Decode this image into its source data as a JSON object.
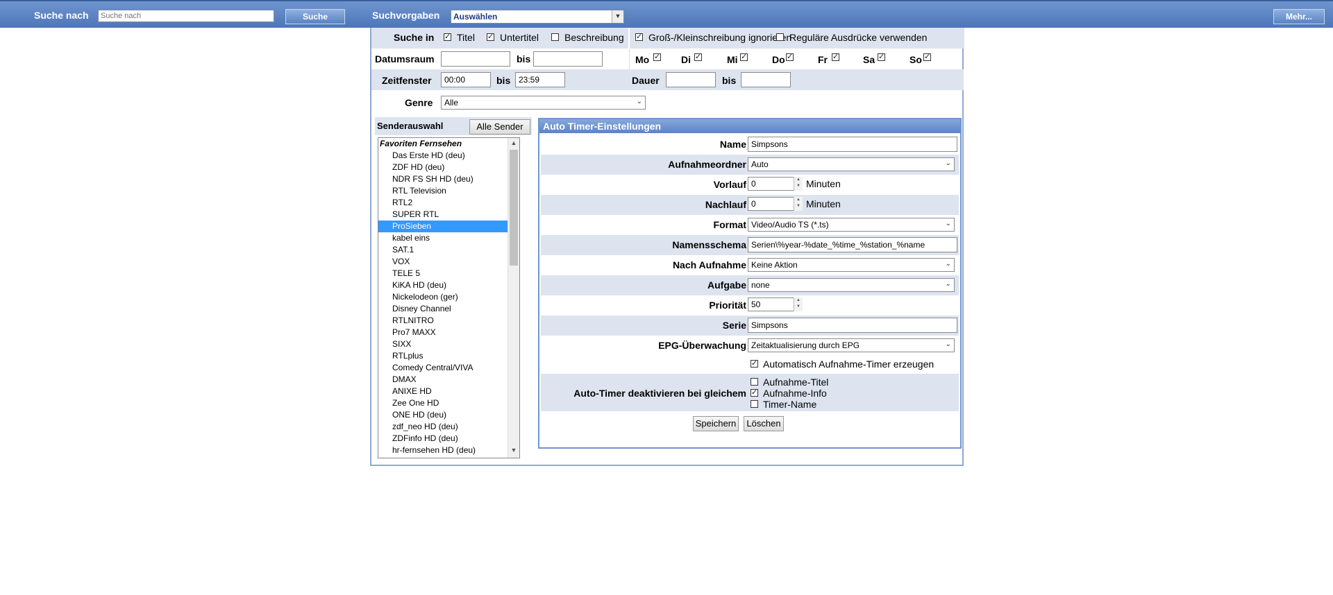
{
  "topbar": {
    "search_label": "Suche nach",
    "search_placeholder": "Suche nach",
    "search_button": "Suche",
    "presets_label": "Suchvorgaben",
    "presets_value": "Auswählen",
    "more_button": "Mehr..."
  },
  "filters": {
    "search_in_label": "Suche in",
    "title_label": "Titel",
    "title_checked": true,
    "subtitle_label": "Untertitel",
    "subtitle_checked": true,
    "description_label": "Beschreibung",
    "description_checked": false,
    "ignore_case_label": "Groß-/Kleinschreibung ignorieren",
    "ignore_case_checked": true,
    "regex_label": "Reguläre Ausdrücke verwenden",
    "regex_checked": false,
    "date_range_label": "Datumsraum",
    "to_label": "bis",
    "date_from": "",
    "date_to": "",
    "weekdays": [
      {
        "label": "Mo",
        "checked": true
      },
      {
        "label": "Di",
        "checked": true
      },
      {
        "label": "Mi",
        "checked": true
      },
      {
        "label": "Do",
        "checked": true
      },
      {
        "label": "Fr",
        "checked": true
      },
      {
        "label": "Sa",
        "checked": true
      },
      {
        "label": "So",
        "checked": true
      }
    ],
    "timeframe_label": "Zeitfenster",
    "time_from": "00:00",
    "time_to": "23:59",
    "duration_label": "Dauer",
    "duration_from": "",
    "duration_to": "",
    "genre_label": "Genre",
    "genre_value": "Alle"
  },
  "channels": {
    "title": "Senderauswahl",
    "all_button": "Alle Sender",
    "group": "Favoriten Fernsehen",
    "selected": "ProSieben",
    "items": [
      "Das Erste HD (deu)",
      "ZDF HD (deu)",
      "NDR FS SH HD (deu)",
      "RTL Television",
      "RTL2",
      "SUPER RTL",
      "ProSieben",
      "kabel eins",
      "SAT.1",
      "VOX",
      "TELE 5",
      "KiKA HD (deu)",
      "Nickelodeon (ger)",
      "Disney Channel",
      "RTLNITRO",
      "Pro7 MAXX",
      "SIXX",
      "RTLplus",
      "Comedy Central/VIVA",
      "DMAX",
      "ANIXE HD",
      "Zee One HD",
      "ONE HD (deu)",
      "zdf_neo HD (deu)",
      "ZDFinfo HD (deu)",
      "hr-fernsehen HD (deu)"
    ]
  },
  "settings": {
    "header": "Auto Timer-Einstellungen",
    "name_label": "Name",
    "name_value": "Simpsons",
    "folder_label": "Aufnahmeordner",
    "folder_value": "Auto",
    "pre_label": "Vorlauf",
    "pre_value": "0",
    "minutes": "Minuten",
    "post_label": "Nachlauf",
    "post_value": "0",
    "format_label": "Format",
    "format_value": "Video/Audio TS (*.ts)",
    "naming_label": "Namensschema",
    "naming_value": "Serien\\%year-%date_%time_%station_%name",
    "after_label": "Nach Aufnahme",
    "after_value": "Keine Aktion",
    "task_label": "Aufgabe",
    "task_value": "none",
    "priority_label": "Priorität",
    "priority_value": "50",
    "series_label": "Serie",
    "series_value": "Simpsons",
    "epg_label": "EPG-Überwachung",
    "epg_value": "Zeitaktualisierung durch EPG",
    "auto_timer_label": "Automatisch Aufnahme-Timer erzeugen",
    "auto_timer_checked": true,
    "deactivate_label": "Auto-Timer deaktivieren bei gleichem",
    "deact_title": "Aufnahme-Titel",
    "deact_title_checked": false,
    "deact_info": "Aufnahme-Info",
    "deact_info_checked": true,
    "deact_timer": "Timer-Name",
    "deact_timer_checked": false,
    "save_button": "Speichern",
    "delete_button": "Löschen"
  }
}
